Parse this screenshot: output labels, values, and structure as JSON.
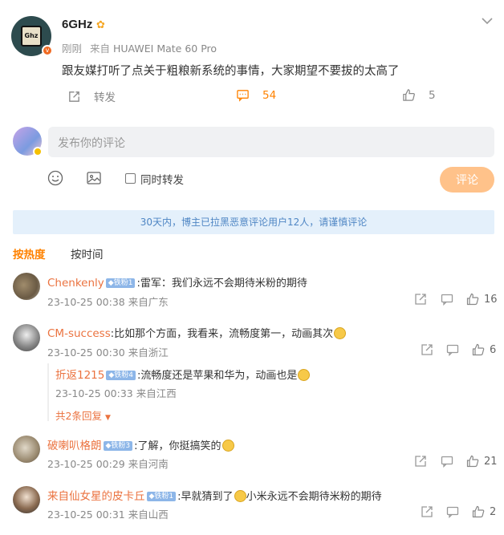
{
  "post": {
    "author": "6GHz",
    "avatar_text": "Ghz",
    "time": "刚刚",
    "source_prefix": "来自",
    "device": "HUAWEI Mate 60 Pro",
    "content": "跟友媒打听了点关于粗粮新系统的事情，大家期望不要拔的太高了",
    "actions": {
      "repost": "转发",
      "comments": "54",
      "likes": "5"
    }
  },
  "composer": {
    "placeholder": "发布你的评论",
    "repost_label": "同时转发",
    "submit_label": "评论"
  },
  "notice": "30天内，博主已拉黑恶意评论用户12人，请谨慎评论",
  "tabs": [
    "按热度",
    "按时间"
  ],
  "comments": [
    {
      "name": "Chenkenly",
      "level": "铁粉1",
      "text": "雷军：我们永远不会期待米粉的期待",
      "time": "23-10-25 00:38 来自广东",
      "likes": "16"
    },
    {
      "name": "CM-success",
      "level": "",
      "text": "比如那个方面，我看来，流畅度第一，动画其次",
      "time": "23-10-25 00:30 来自浙江",
      "likes": "6"
    },
    {
      "name": "折返1215",
      "level": "铁粉4",
      "text": "流畅度还是苹果和华为，动画也是",
      "time": "23-10-25 00:33 来自江西",
      "likes": ""
    },
    {
      "name": "破喇叭格朗",
      "level": "铁粉3",
      "text": "了解，你挺搞笑的",
      "time": "23-10-25 00:29 来自河南",
      "likes": "21"
    },
    {
      "name": "来自仙女星的皮卡丘",
      "level": "铁粉1",
      "text_a": "早就猜到了",
      "text_b": "小米永远不会期待米粉的期待",
      "time": "23-10-25 00:31 来自山西",
      "likes": "2"
    }
  ],
  "reply_more": "共2条回复",
  "colors": {
    "accent": "#ff8200",
    "name": "#eb7340",
    "notice_bg": "#e4f0fb"
  }
}
